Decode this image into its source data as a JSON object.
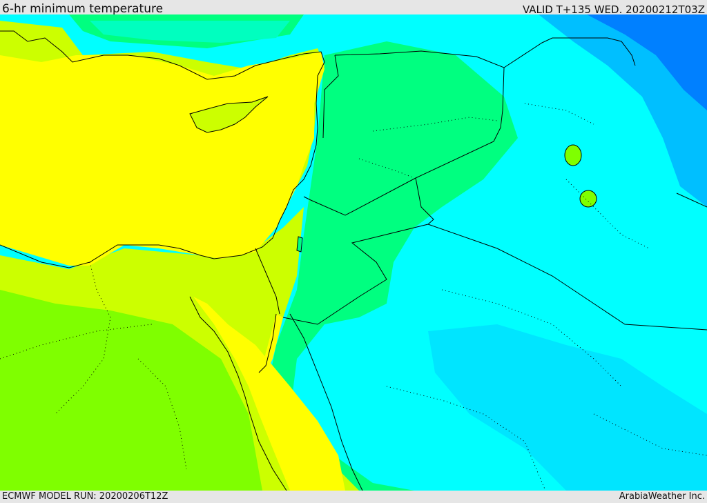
{
  "header": {
    "title": "6-hr minimum temperature",
    "valid": "VALID T+135 WED. 20200212T03Z"
  },
  "footer": {
    "model_run": "ECMWF MODEL RUN: 20200206T12Z",
    "credit": "ArabiaWeather Inc."
  },
  "map": {
    "colors": {
      "yellow": "#ffff00",
      "yellow_green": "#ccff00",
      "light_green": "#99ff00",
      "green": "#7fff00",
      "spring_green": "#00ff80",
      "cyan_green": "#00ffbf",
      "cyan": "#00ffff",
      "sky": "#00e5ff",
      "light_blue": "#00bfff",
      "blue": "#0080ff",
      "border": "#000000"
    }
  }
}
